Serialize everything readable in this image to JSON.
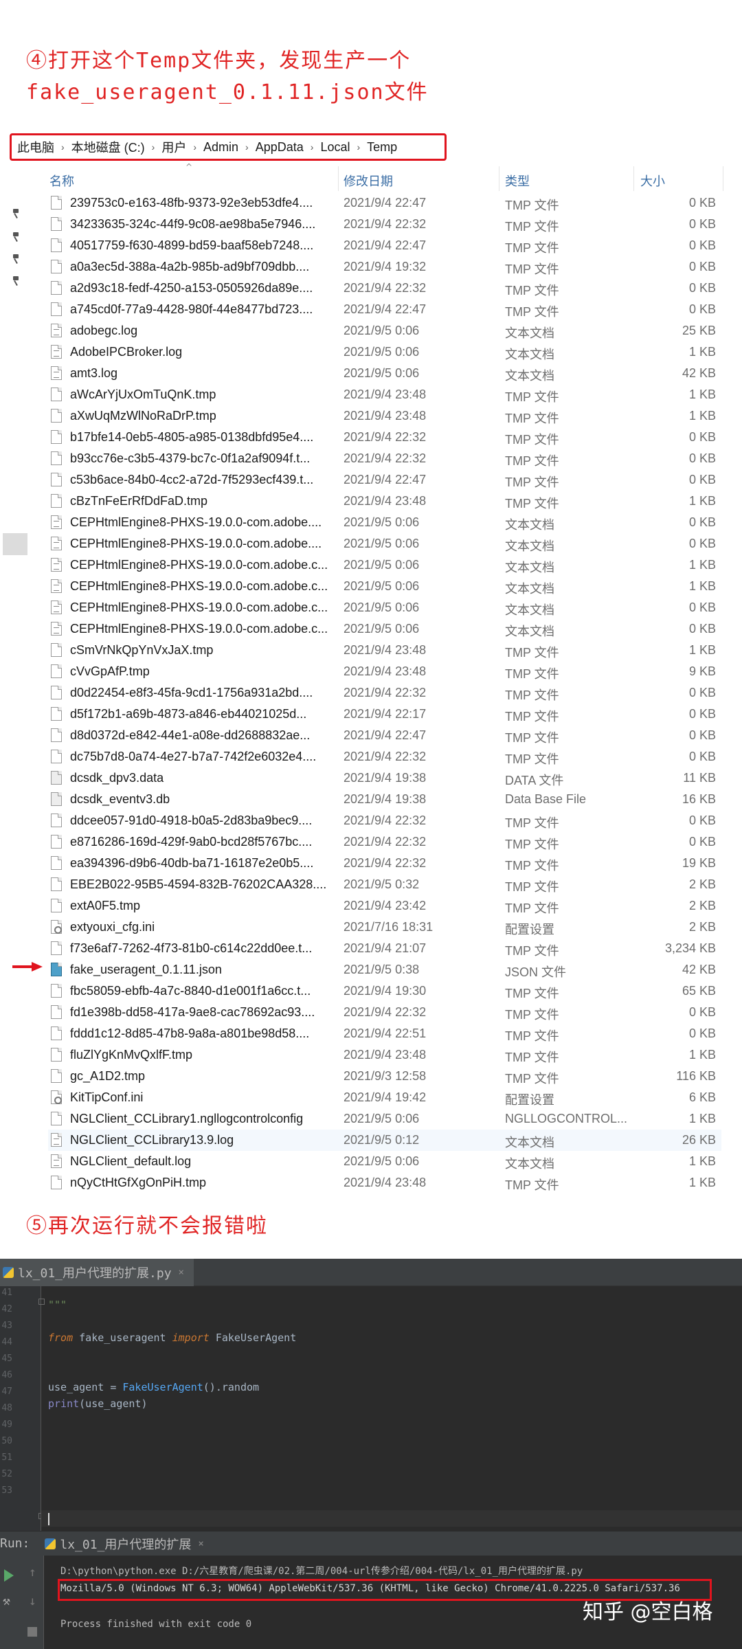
{
  "annotations": {
    "step4": "④打开这个Temp文件夹，发现生产一个fake_useragent_0.1.11.json文件",
    "step5": "⑤再次运行就不会报错啦"
  },
  "explorer": {
    "breadcrumb": [
      "此电脑",
      "本地磁盘 (C:)",
      "用户",
      "Admin",
      "AppData",
      "Local",
      "Temp"
    ],
    "columns": {
      "name": "名称",
      "date": "修改日期",
      "type": "类型",
      "size": "大小"
    },
    "files": [
      {
        "name": "239753c0-e163-48fb-9373-92e3eb53dfe4....",
        "date": "2021/9/4 22:47",
        "type": "TMP 文件",
        "size": "0 KB",
        "icon": "file"
      },
      {
        "name": "34233635-324c-44f9-9c08-ae98ba5e7946....",
        "date": "2021/9/4 22:32",
        "type": "TMP 文件",
        "size": "0 KB",
        "icon": "file"
      },
      {
        "name": "40517759-f630-4899-bd59-baaf58eb7248....",
        "date": "2021/9/4 22:47",
        "type": "TMP 文件",
        "size": "0 KB",
        "icon": "file"
      },
      {
        "name": "a0a3ec5d-388a-4a2b-985b-ad9bf709dbb....",
        "date": "2021/9/4 19:32",
        "type": "TMP 文件",
        "size": "0 KB",
        "icon": "file"
      },
      {
        "name": "a2d93c18-fedf-4250-a153-0505926da89e....",
        "date": "2021/9/4 22:32",
        "type": "TMP 文件",
        "size": "0 KB",
        "icon": "file"
      },
      {
        "name": "a745cd0f-77a9-4428-980f-44e8477bd723....",
        "date": "2021/9/4 22:47",
        "type": "TMP 文件",
        "size": "0 KB",
        "icon": "file"
      },
      {
        "name": "adobegc.log",
        "date": "2021/9/5 0:06",
        "type": "文本文档",
        "size": "25 KB",
        "icon": "log"
      },
      {
        "name": "AdobeIPCBroker.log",
        "date": "2021/9/5 0:06",
        "type": "文本文档",
        "size": "1 KB",
        "icon": "log"
      },
      {
        "name": "amt3.log",
        "date": "2021/9/5 0:06",
        "type": "文本文档",
        "size": "42 KB",
        "icon": "log"
      },
      {
        "name": "aWcArYjUxOmTuQnK.tmp",
        "date": "2021/9/4 23:48",
        "type": "TMP 文件",
        "size": "1 KB",
        "icon": "file"
      },
      {
        "name": "aXwUqMzWlNoRaDrP.tmp",
        "date": "2021/9/4 23:48",
        "type": "TMP 文件",
        "size": "1 KB",
        "icon": "file"
      },
      {
        "name": "b17bfe14-0eb5-4805-a985-0138dbfd95e4....",
        "date": "2021/9/4 22:32",
        "type": "TMP 文件",
        "size": "0 KB",
        "icon": "file"
      },
      {
        "name": "b93cc76e-c3b5-4379-bc7c-0f1a2af9094f.t...",
        "date": "2021/9/4 22:32",
        "type": "TMP 文件",
        "size": "0 KB",
        "icon": "file"
      },
      {
        "name": "c53b6ace-84b0-4cc2-a72d-7f5293ecf439.t...",
        "date": "2021/9/4 22:47",
        "type": "TMP 文件",
        "size": "0 KB",
        "icon": "file"
      },
      {
        "name": "cBzTnFeErRfDdFaD.tmp",
        "date": "2021/9/4 23:48",
        "type": "TMP 文件",
        "size": "1 KB",
        "icon": "file"
      },
      {
        "name": "CEPHtmlEngine8-PHXS-19.0.0-com.adobe....",
        "date": "2021/9/5 0:06",
        "type": "文本文档",
        "size": "0 KB",
        "icon": "log"
      },
      {
        "name": "CEPHtmlEngine8-PHXS-19.0.0-com.adobe....",
        "date": "2021/9/5 0:06",
        "type": "文本文档",
        "size": "0 KB",
        "icon": "log"
      },
      {
        "name": "CEPHtmlEngine8-PHXS-19.0.0-com.adobe.c...",
        "date": "2021/9/5 0:06",
        "type": "文本文档",
        "size": "1 KB",
        "icon": "log"
      },
      {
        "name": "CEPHtmlEngine8-PHXS-19.0.0-com.adobe.c...",
        "date": "2021/9/5 0:06",
        "type": "文本文档",
        "size": "1 KB",
        "icon": "log"
      },
      {
        "name": "CEPHtmlEngine8-PHXS-19.0.0-com.adobe.c...",
        "date": "2021/9/5 0:06",
        "type": "文本文档",
        "size": "0 KB",
        "icon": "log"
      },
      {
        "name": "CEPHtmlEngine8-PHXS-19.0.0-com.adobe.c...",
        "date": "2021/9/5 0:06",
        "type": "文本文档",
        "size": "0 KB",
        "icon": "log"
      },
      {
        "name": "cSmVrNkQpYnVxJaX.tmp",
        "date": "2021/9/4 23:48",
        "type": "TMP 文件",
        "size": "1 KB",
        "icon": "file"
      },
      {
        "name": "cVvGpAfP.tmp",
        "date": "2021/9/4 23:48",
        "type": "TMP 文件",
        "size": "9 KB",
        "icon": "file"
      },
      {
        "name": "d0d22454-e8f3-45fa-9cd1-1756a931a2bd....",
        "date": "2021/9/4 22:32",
        "type": "TMP 文件",
        "size": "0 KB",
        "icon": "file"
      },
      {
        "name": "d5f172b1-a69b-4873-a846-eb44021025d...",
        "date": "2021/9/4 22:17",
        "type": "TMP 文件",
        "size": "0 KB",
        "icon": "file"
      },
      {
        "name": "d8d0372d-e842-44e1-a08e-dd2688832ae...",
        "date": "2021/9/4 22:47",
        "type": "TMP 文件",
        "size": "0 KB",
        "icon": "file"
      },
      {
        "name": "dc75b7d8-0a74-4e27-b7a7-742f2e6032e4....",
        "date": "2021/9/4 22:32",
        "type": "TMP 文件",
        "size": "0 KB",
        "icon": "file"
      },
      {
        "name": "dcsdk_dpv3.data",
        "date": "2021/9/4 19:38",
        "type": "DATA 文件",
        "size": "11 KB",
        "icon": "data"
      },
      {
        "name": "dcsdk_eventv3.db",
        "date": "2021/9/4 19:38",
        "type": "Data Base File",
        "size": "16 KB",
        "icon": "data"
      },
      {
        "name": "ddcee057-91d0-4918-b0a5-2d83ba9bec9....",
        "date": "2021/9/4 22:32",
        "type": "TMP 文件",
        "size": "0 KB",
        "icon": "file"
      },
      {
        "name": "e8716286-169d-429f-9ab0-bcd28f5767bc....",
        "date": "2021/9/4 22:32",
        "type": "TMP 文件",
        "size": "0 KB",
        "icon": "file"
      },
      {
        "name": "ea394396-d9b6-40db-ba71-16187e2e0b5....",
        "date": "2021/9/4 22:32",
        "type": "TMP 文件",
        "size": "19 KB",
        "icon": "file"
      },
      {
        "name": "EBE2B022-95B5-4594-832B-76202CAA328....",
        "date": "2021/9/5 0:32",
        "type": "TMP 文件",
        "size": "2 KB",
        "icon": "file"
      },
      {
        "name": "extA0F5.tmp",
        "date": "2021/9/4 23:42",
        "type": "TMP 文件",
        "size": "2 KB",
        "icon": "file"
      },
      {
        "name": "extyouxi_cfg.ini",
        "date": "2021/7/16 18:31",
        "type": "配置设置",
        "size": "2 KB",
        "icon": "ini"
      },
      {
        "name": "f73e6af7-7262-4f73-81b0-c614c22dd0ee.t...",
        "date": "2021/9/4 21:07",
        "type": "TMP 文件",
        "size": "3,234 KB",
        "icon": "file"
      },
      {
        "name": "fake_useragent_0.1.11.json",
        "date": "2021/9/5 0:38",
        "type": "JSON 文件",
        "size": "42 KB",
        "icon": "json"
      },
      {
        "name": "fbc58059-ebfb-4a7c-8840-d1e001f1a6cc.t...",
        "date": "2021/9/4 19:30",
        "type": "TMP 文件",
        "size": "65 KB",
        "icon": "file"
      },
      {
        "name": "fd1e398b-dd58-417a-9ae8-cac78692ac93....",
        "date": "2021/9/4 22:32",
        "type": "TMP 文件",
        "size": "0 KB",
        "icon": "file"
      },
      {
        "name": "fddd1c12-8d85-47b8-9a8a-a801be98d58....",
        "date": "2021/9/4 22:51",
        "type": "TMP 文件",
        "size": "0 KB",
        "icon": "file"
      },
      {
        "name": "fluZlYgKnMvQxlfF.tmp",
        "date": "2021/9/4 23:48",
        "type": "TMP 文件",
        "size": "1 KB",
        "icon": "file"
      },
      {
        "name": "gc_A1D2.tmp",
        "date": "2021/9/3 12:58",
        "type": "TMP 文件",
        "size": "116 KB",
        "icon": "file"
      },
      {
        "name": "KitTipConf.ini",
        "date": "2021/9/4 19:42",
        "type": "配置设置",
        "size": "6 KB",
        "icon": "ini"
      },
      {
        "name": "NGLClient_CCLibrary1.ngllogcontrolconfig",
        "date": "2021/9/5 0:06",
        "type": "NGLLOGCONTROL...",
        "size": "1 KB",
        "icon": "file"
      },
      {
        "name": "NGLClient_CCLibrary13.9.log",
        "date": "2021/9/5 0:12",
        "type": "文本文档",
        "size": "26 KB",
        "icon": "log",
        "selected": true
      },
      {
        "name": "NGLClient_default.log",
        "date": "2021/9/5 0:06",
        "type": "文本文档",
        "size": "1 KB",
        "icon": "log"
      },
      {
        "name": "nQyCtHtGfXgOnPiH.tmp",
        "date": "2021/9/4 23:48",
        "type": "TMP 文件",
        "size": "1 KB",
        "icon": "file"
      }
    ]
  },
  "ide": {
    "tab": "lx_01_用户代理的扩展.py",
    "line_numbers": [
      "41",
      "42",
      "43",
      "44",
      "45",
      "46",
      "47",
      "48",
      "49",
      "50",
      "51",
      "52",
      "53"
    ],
    "code": {
      "docstring": "\"\"\"",
      "import_from": "from",
      "import_module": "fake_useragent",
      "import_kw": "import",
      "import_name": "FakeUserAgent",
      "assign_var": "use_agent",
      "assign_eq": "=",
      "assign_call": "FakeUserAgent",
      "assign_tail": "().random",
      "print_fn": "print",
      "print_args": "(use_agent)"
    },
    "run": {
      "label": "Run:",
      "tab": "lx_01_用户代理的扩展",
      "command": "D:\\python\\python.exe D:/六星教育/爬虫课/02.第二周/004-url传参介绍/004-代码/lx_01_用户代理的扩展.py",
      "output": "Mozilla/5.0 (Windows NT 6.3; WOW64) AppleWebKit/537.36 (KHTML, like Gecko) Chrome/41.0.2225.0 Safari/537.36",
      "exit": "Process finished with exit code 0"
    }
  },
  "watermark": "知乎 @空白格",
  "colors": {
    "annotation": "#e02424",
    "highlight_box": "#e0141e",
    "ide_bg": "#2b2b2b"
  }
}
